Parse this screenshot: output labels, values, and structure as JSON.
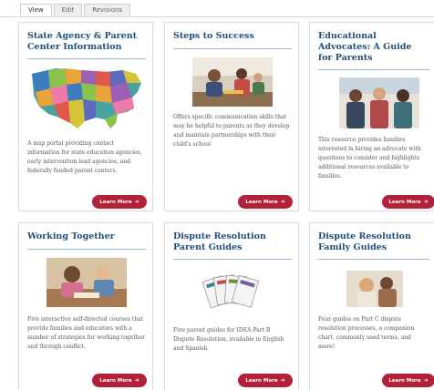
{
  "tabs": [
    "View",
    "Edit",
    "Revisions"
  ],
  "cards": [
    {
      "title": "State Agency & Parent Center Information",
      "description": "A map portal providing contact information for state education agencies, early intervention lead agencies, and federally funded parent centers.",
      "button": "Learn More"
    },
    {
      "title": "Steps to Success",
      "description": "Offers specific communication skills that may be helpful to parents as they develop and maintain partnerships with their child's school",
      "button": "Learn More"
    },
    {
      "title": "Educational Advocates: A Guide for Parents",
      "description": "This resource provides families interested in hiring an advocate with questions to consider and highlights additional resources available to families.",
      "button": "Learn More"
    },
    {
      "title": "Working Together",
      "description": "Five interactive self-directed courses that provide families and educators with a number of strategies for working together and through conflict.",
      "button": "Learn More"
    },
    {
      "title": "Dispute Resolution Parent Guides",
      "description": "Five parent guides for IDEA Part B Dispute Resolution, available in English and Spanish",
      "button": "Learn More"
    },
    {
      "title": "Dispute Resolution Family Guides",
      "description": "Four guides on Part C dispute resolution processes, a companion chart, commonly used terms, and more!",
      "button": "Learn More"
    }
  ],
  "colors": {
    "title": "#1f4e79",
    "button": "#b3203a",
    "rule": "#9bb6cf"
  }
}
